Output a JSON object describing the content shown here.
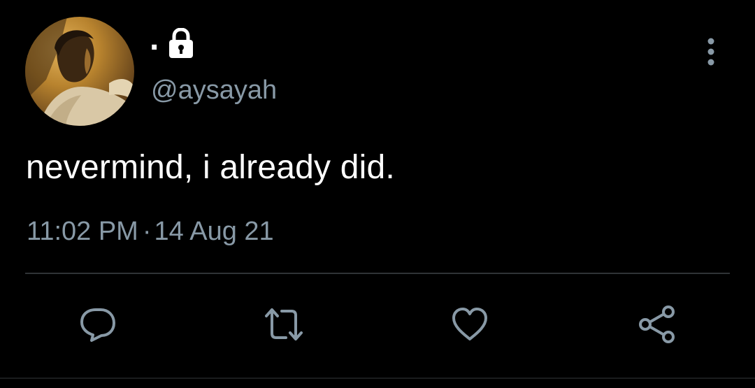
{
  "tweet": {
    "display_name": ".",
    "handle": "@aysayah",
    "text": "nevermind, i already did.",
    "time": "11:02 PM",
    "separator": "·",
    "date": "14 Aug 21"
  },
  "icons": {
    "avatar": "profile-photo",
    "lock": "lock-icon",
    "more": "more-vertical-icon",
    "reply": "reply-icon",
    "retweet": "retweet-icon",
    "like": "heart-icon",
    "share": "share-icon"
  },
  "colors": {
    "background": "#000000",
    "text_primary": "#ffffff",
    "text_secondary": "#8899a6",
    "divider": "#2f3336"
  }
}
